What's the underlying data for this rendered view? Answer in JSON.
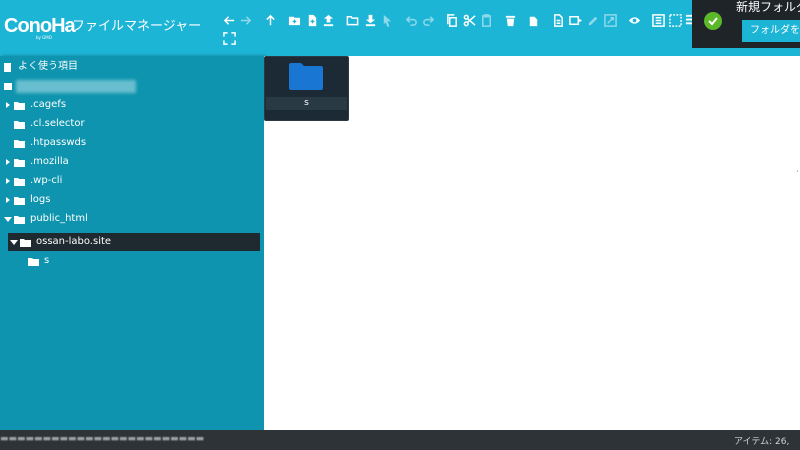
{
  "header": {
    "logo": "ConoHa",
    "logo_sub": "by GMO",
    "app_title": "ファイルマネージャー",
    "bg_color": "#1db5d6"
  },
  "toolbar": {
    "icons": [
      "back-arrow-icon",
      "forward-arrow-icon",
      "up-arrow-icon",
      "new-folder-icon",
      "new-file-icon",
      "upload-icon",
      "open-folder-icon",
      "download-icon",
      "select-pointer-icon",
      "undo-icon",
      "redo-icon",
      "copy-icon",
      "cut-icon",
      "paste-icon",
      "delete-icon",
      "duplicate-icon",
      "rename-icon",
      "extract-icon",
      "edit-icon",
      "resize-icon",
      "preview-icon",
      "grid-view-icon",
      "select-all-icon",
      "list-view-icon",
      "fullscreen-icon"
    ]
  },
  "notification": {
    "title": "新規フォルダ",
    "button_label": "フォルダを"
  },
  "sidebar": {
    "favorites_label": "よく使う項目",
    "tree": [
      {
        "label": ".cagefs",
        "expandable": true
      },
      {
        "label": ".cl.selector",
        "expandable": false
      },
      {
        "label": ".htpasswds",
        "expandable": false
      },
      {
        "label": ".mozilla",
        "expandable": true
      },
      {
        "label": ".wp-cli",
        "expandable": true
      },
      {
        "label": "logs",
        "expandable": true
      },
      {
        "label": "public_html",
        "expandable": true,
        "expanded": true
      }
    ],
    "selected_item": "ossan-labo.site",
    "child_item": "s"
  },
  "main": {
    "folder_label": "s",
    "folder_color": "#1976d2"
  },
  "statusbar": {
    "items_label": "アイテム: 26,"
  }
}
